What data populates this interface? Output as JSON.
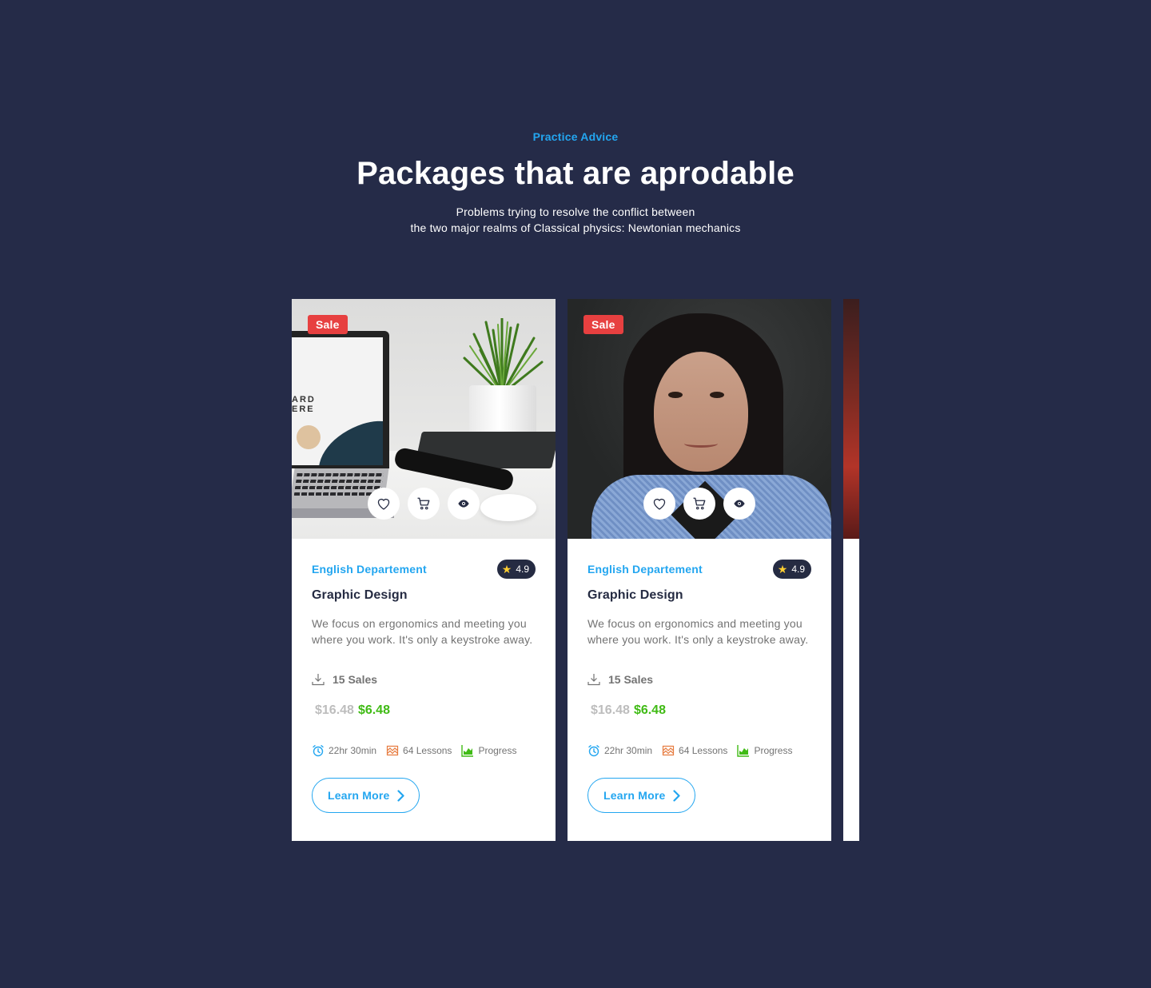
{
  "header": {
    "eyebrow": "Practice Advice",
    "headline": "Packages that are aprodable",
    "subtext_line1": "Problems trying to resolve the conflict between",
    "subtext_line2": "the two major realms of Classical physics: Newtonian mechanics"
  },
  "colors": {
    "background": "#252B48",
    "accent": "#23A6F0",
    "sale": "#E74040",
    "price_new": "#40BB15",
    "price_old": "#BDBDBD",
    "star": "#FFCE31"
  },
  "cards": [
    {
      "badge": "Sale",
      "image_text": "ARD\nERE",
      "department": "English Departement",
      "rating": "4.9",
      "title": "Graphic Design",
      "description": "We focus on ergonomics and meeting you where you work. It's only a keystroke away.",
      "sales": "15 Sales",
      "old_price": "$16.48",
      "new_price": "$6.48",
      "duration": "22hr 30min",
      "lessons": "64 Lessons",
      "progress": "Progress",
      "button": "Learn More"
    },
    {
      "badge": "Sale",
      "department": "English Departement",
      "rating": "4.9",
      "title": "Graphic Design",
      "description": "We focus on ergonomics and meeting you where you work. It's only a keystroke away.",
      "sales": "15 Sales",
      "old_price": "$16.48",
      "new_price": "$6.48",
      "duration": "22hr 30min",
      "lessons": "64 Lessons",
      "progress": "Progress",
      "button": "Learn More"
    }
  ],
  "icons": [
    "heart-icon",
    "cart-icon",
    "eye-icon",
    "star-icon",
    "download-icon",
    "alarm-icon",
    "lessons-icon",
    "chart-icon",
    "chevron-right-icon"
  ]
}
